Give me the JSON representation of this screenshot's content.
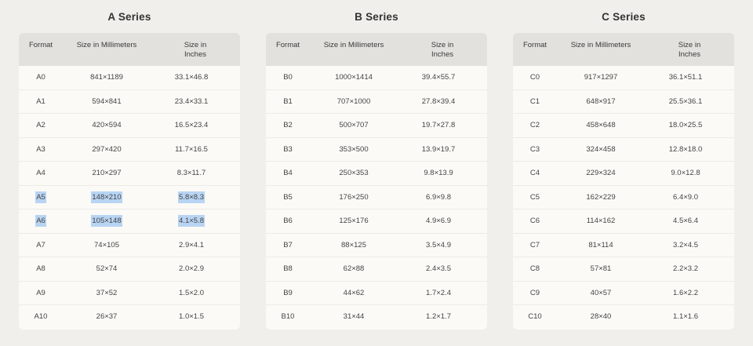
{
  "headers": {
    "format": "Format",
    "mm": "Size in Millimeters",
    "inches": "Size in Inches"
  },
  "highlight_color": "#b8d4f3",
  "series": [
    {
      "title": "A Series",
      "rows": [
        {
          "format": "A0",
          "mm": "841×1189",
          "inches": "33.1×46.8",
          "selected": false
        },
        {
          "format": "A1",
          "mm": "594×841",
          "inches": "23.4×33.1",
          "selected": false
        },
        {
          "format": "A2",
          "mm": "420×594",
          "inches": "16.5×23.4",
          "selected": false
        },
        {
          "format": "A3",
          "mm": "297×420",
          "inches": "11.7×16.5",
          "selected": false
        },
        {
          "format": "A4",
          "mm": "210×297",
          "inches": "8.3×11.7",
          "selected": false
        },
        {
          "format": "A5",
          "mm": "148×210",
          "inches": "5.8×8.3",
          "selected": true
        },
        {
          "format": "A6",
          "mm": "105×148",
          "inches": "4.1×5.8",
          "selected": true
        },
        {
          "format": "A7",
          "mm": "74×105",
          "inches": "2.9×4.1",
          "selected": false
        },
        {
          "format": "A8",
          "mm": "52×74",
          "inches": "2.0×2.9",
          "selected": false
        },
        {
          "format": "A9",
          "mm": "37×52",
          "inches": "1.5×2.0",
          "selected": false
        },
        {
          "format": "A10",
          "mm": "26×37",
          "inches": "1.0×1.5",
          "selected": false
        }
      ]
    },
    {
      "title": "B Series",
      "rows": [
        {
          "format": "B0",
          "mm": "1000×1414",
          "inches": "39.4×55.7",
          "selected": false
        },
        {
          "format": "B1",
          "mm": "707×1000",
          "inches": "27.8×39.4",
          "selected": false
        },
        {
          "format": "B2",
          "mm": "500×707",
          "inches": "19.7×27.8",
          "selected": false
        },
        {
          "format": "B3",
          "mm": "353×500",
          "inches": "13.9×19.7",
          "selected": false
        },
        {
          "format": "B4",
          "mm": "250×353",
          "inches": "9.8×13.9",
          "selected": false
        },
        {
          "format": "B5",
          "mm": "176×250",
          "inches": "6.9×9.8",
          "selected": false
        },
        {
          "format": "B6",
          "mm": "125×176",
          "inches": "4.9×6.9",
          "selected": false
        },
        {
          "format": "B7",
          "mm": "88×125",
          "inches": "3.5×4.9",
          "selected": false
        },
        {
          "format": "B8",
          "mm": "62×88",
          "inches": "2.4×3.5",
          "selected": false
        },
        {
          "format": "B9",
          "mm": "44×62",
          "inches": "1.7×2.4",
          "selected": false
        },
        {
          "format": "B10",
          "mm": "31×44",
          "inches": "1.2×1.7",
          "selected": false
        }
      ]
    },
    {
      "title": "C Series",
      "rows": [
        {
          "format": "C0",
          "mm": "917×1297",
          "inches": "36.1×51.1",
          "selected": false
        },
        {
          "format": "C1",
          "mm": "648×917",
          "inches": "25.5×36.1",
          "selected": false
        },
        {
          "format": "C2",
          "mm": "458×648",
          "inches": "18.0×25.5",
          "selected": false
        },
        {
          "format": "C3",
          "mm": "324×458",
          "inches": "12.8×18.0",
          "selected": false
        },
        {
          "format": "C4",
          "mm": "229×324",
          "inches": "9.0×12.8",
          "selected": false
        },
        {
          "format": "C5",
          "mm": "162×229",
          "inches": "6.4×9.0",
          "selected": false
        },
        {
          "format": "C6",
          "mm": "114×162",
          "inches": "4.5×6.4",
          "selected": false
        },
        {
          "format": "C7",
          "mm": "81×114",
          "inches": "3.2×4.5",
          "selected": false
        },
        {
          "format": "C8",
          "mm": "57×81",
          "inches": "2.2×3.2",
          "selected": false
        },
        {
          "format": "C9",
          "mm": "40×57",
          "inches": "1.6×2.2",
          "selected": false
        },
        {
          "format": "C10",
          "mm": "28×40",
          "inches": "1.1×1.6",
          "selected": false
        }
      ]
    }
  ]
}
